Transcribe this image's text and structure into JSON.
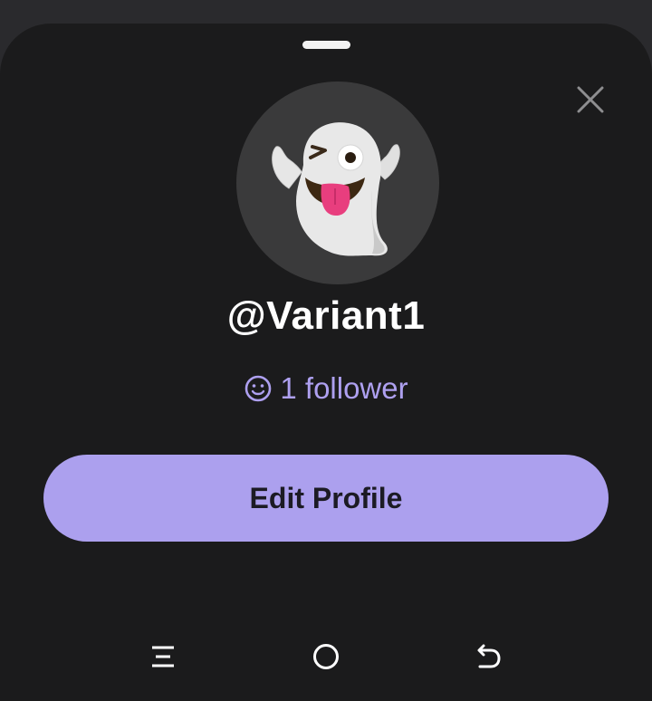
{
  "profile": {
    "username": "@Variant1",
    "followers_text": "1 follower",
    "avatar_icon": "ghost-emoji-winking-tongue"
  },
  "actions": {
    "edit_profile_label": "Edit Profile",
    "close_icon": "close-icon"
  },
  "navbar": {
    "recents_icon": "recents-icon",
    "home_icon": "home-icon",
    "back_icon": "back-icon"
  },
  "colors": {
    "sheet_bg": "#1b1b1c",
    "accent": "#aca0ee",
    "follower_text": "#aea0f0",
    "avatar_bg": "#3a3a3b"
  }
}
